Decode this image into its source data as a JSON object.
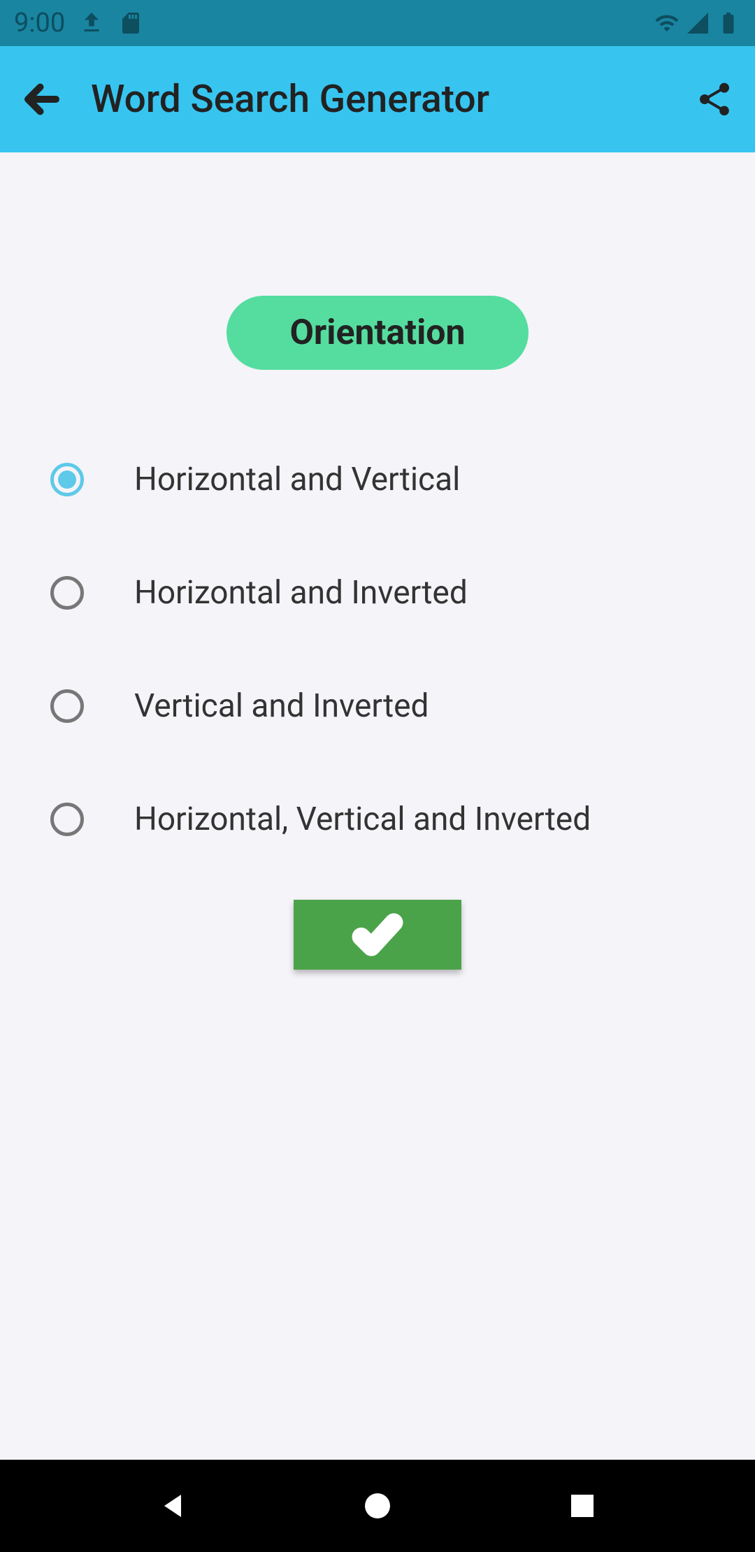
{
  "status": {
    "time": "9:00"
  },
  "header": {
    "title": "Word Search Generator"
  },
  "main": {
    "section_title": "Orientation",
    "options": [
      {
        "label": "Horizontal and Vertical",
        "selected": true
      },
      {
        "label": "Horizontal and Inverted",
        "selected": false
      },
      {
        "label": "Vertical and Inverted",
        "selected": false
      },
      {
        "label": "Horizontal, Vertical and Inverted",
        "selected": false
      }
    ]
  }
}
